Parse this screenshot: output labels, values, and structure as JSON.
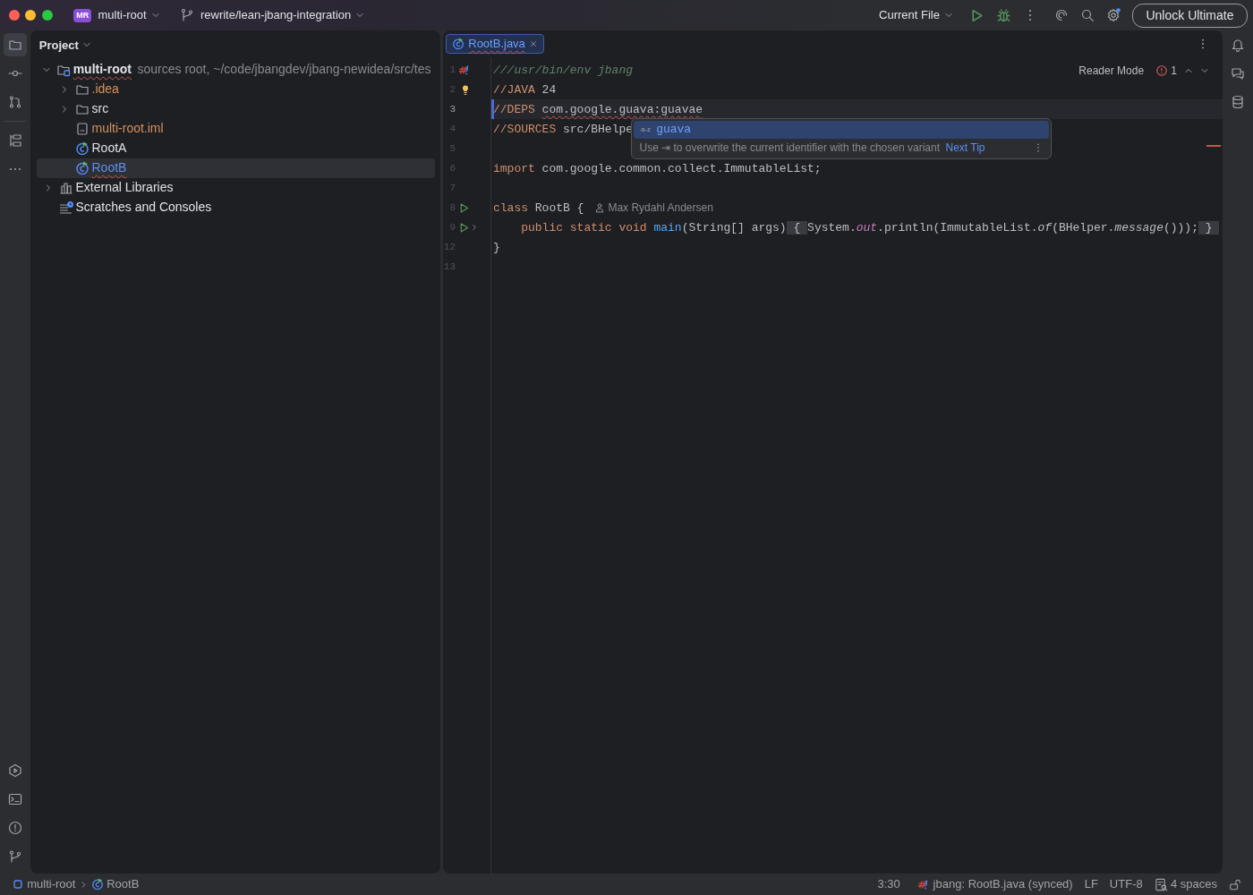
{
  "titlebar": {
    "project_badge": "MR",
    "project": "multi-root",
    "branch": "rewrite/lean-jbang-integration",
    "run_config": "Current File",
    "unlock_button": "Unlock Ultimate",
    "settings_update": true
  },
  "project_panel": {
    "title": "Project",
    "tree": [
      {
        "label": "multi-root",
        "kind": "module",
        "hint": "sources root,  ~/code/jbangdev/jbang-newidea/src/tes",
        "expanded": true,
        "selected": false,
        "ignored": false,
        "error": true,
        "children": [
          {
            "label": ".idea",
            "kind": "folder",
            "expanded": false,
            "selected": false,
            "ignored": true,
            "error": false
          },
          {
            "label": "src",
            "kind": "folder",
            "expanded": false,
            "selected": false,
            "ignored": false,
            "error": false
          },
          {
            "label": "multi-root.iml",
            "kind": "file",
            "selected": false,
            "ignored": true,
            "error": false
          },
          {
            "label": "RootA",
            "kind": "class",
            "selected": false,
            "ignored": false,
            "error": false
          },
          {
            "label": "RootB",
            "kind": "class",
            "selected": true,
            "ignored": false,
            "error": true
          }
        ]
      },
      {
        "label": "External Libraries",
        "kind": "libraries",
        "expanded": false,
        "selected": false,
        "ignored": false,
        "error": false
      },
      {
        "label": "Scratches and Consoles",
        "kind": "scratches",
        "selected": false,
        "ignored": false,
        "error": false
      }
    ]
  },
  "editor": {
    "tabs": [
      {
        "label": "RootB.java",
        "selected": true,
        "error": true
      }
    ],
    "reader_mode": "Reader Mode",
    "error_count": "1",
    "lines": [
      {
        "number": "1",
        "current": false,
        "gutter": {
          "kind": "jbang"
        },
        "segments": [
          {
            "kind": "doc",
            "text": "///usr/bin/env jbang"
          }
        ]
      },
      {
        "number": "2",
        "current": false,
        "gutter": {
          "kind": "bulb"
        },
        "segments": [
          {
            "kind": "directive",
            "text": "//JAVA"
          },
          {
            "kind": "text",
            "text": " 24"
          }
        ]
      },
      {
        "number": "3",
        "current": true,
        "segments": [
          {
            "kind": "directive",
            "text": "//DEPS"
          },
          {
            "kind": "error",
            "text": "com.google.guava:guavae"
          }
        ]
      },
      {
        "number": "4",
        "current": false,
        "segments": [
          {
            "kind": "directive",
            "text": "//SOURCES"
          },
          {
            "kind": "text",
            "text": " src/BHelpe"
          }
        ]
      },
      {
        "number": "5",
        "current": false
      },
      {
        "number": "6",
        "current": false,
        "segments": [
          {
            "kind": "keyword",
            "text": "import"
          },
          {
            "kind": "text",
            "text": " com.google.common.collect.ImmutableList;"
          }
        ]
      },
      {
        "number": "7",
        "current": false
      },
      {
        "number": "8",
        "current": false,
        "gutter": {
          "kind": "run"
        },
        "author": "Max Rydahl Andersen",
        "segments": [
          {
            "kind": "keyword",
            "text": "class"
          },
          {
            "kind": "text",
            "text": " RootB {"
          }
        ],
        "children": [
          {
            "number": "9",
            "current": false,
            "gutter": {
              "kind": "run-fold"
            },
            "segments": [
              {
                "kind": "keyword",
                "text": "public static void"
              },
              {
                "kind": "method",
                "text": " main"
              },
              {
                "kind": "text",
                "text": "(String[] args)"
              },
              {
                "kind": "fold",
                "text": " { "
              },
              {
                "kind": "text",
                "text": "System."
              },
              {
                "kind": "field",
                "text": "out"
              },
              {
                "kind": "text",
                "text": ".println(ImmutableList."
              },
              {
                "kind": "italic",
                "text": "of"
              },
              {
                "kind": "text",
                "text": "(BHelper."
              },
              {
                "kind": "italic",
                "text": "message"
              },
              {
                "kind": "text",
                "text": "()));"
              },
              {
                "kind": "fold",
                "text": " } "
              }
            ]
          }
        ]
      },
      {
        "number": "12",
        "current": false,
        "segments": [
          {
            "kind": "text",
            "text": "}"
          }
        ]
      },
      {
        "number": "13",
        "current": false
      }
    ],
    "completion": {
      "items": [
        {
          "type_label": "a-z",
          "label": "guava",
          "selected": true
        }
      ],
      "hint": "Use ⇥ to overwrite the current identifier with the chosen variant",
      "next_tip": "Next Tip"
    }
  },
  "status_bar": {
    "breadcrumbs": [
      {
        "label": "multi-root",
        "kind": "module"
      },
      {
        "label": "RootB",
        "kind": "class"
      }
    ],
    "position": "3:30",
    "jbang": "jbang: RootB.java (synced)",
    "line_separator": "LF",
    "encoding": "UTF-8",
    "indent": "4 spaces"
  }
}
